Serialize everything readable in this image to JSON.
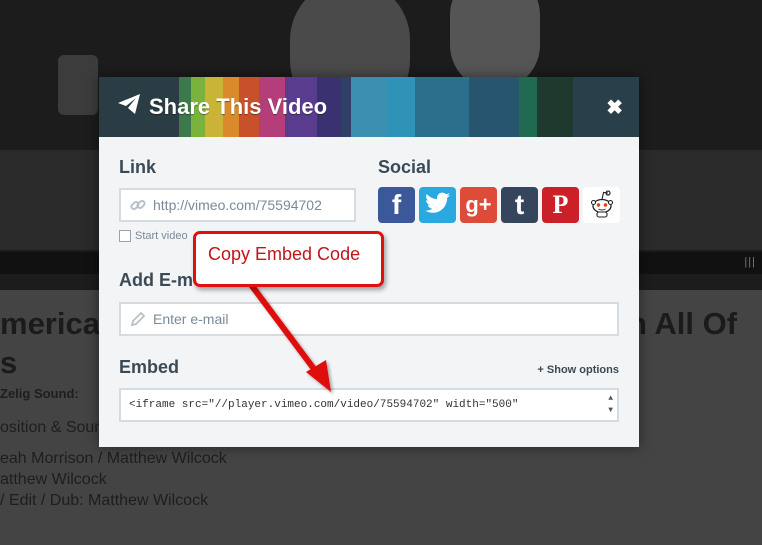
{
  "background": {
    "title_left_line1": "merica",
    "title_left_line2": "s",
    "title_right": "n All Of",
    "credits_line": "Zelig Sound:",
    "line1": "osition & Sound",
    "line2": "eah Morrison / Matthew Wilcock",
    "line3": "atthew Wilcock",
    "line4": "/ Edit / Dub: Matthew Wilcock"
  },
  "modal": {
    "title": "Share This Video",
    "close_glyph": "✖",
    "link": {
      "label": "Link",
      "value": "http://vimeo.com/75594702",
      "checkbox_label": "Start video"
    },
    "social": {
      "label": "Social",
      "buttons": [
        {
          "name": "facebook",
          "glyph": "f",
          "color": "#3b5998"
        },
        {
          "name": "twitter",
          "glyph": "t",
          "color": "#2aa9e0"
        },
        {
          "name": "google-plus",
          "glyph": "g+",
          "color": "#dd4b39"
        },
        {
          "name": "tumblr",
          "glyph": "t",
          "color": "#35465c"
        },
        {
          "name": "pinterest",
          "glyph": "P",
          "color": "#cb2027"
        },
        {
          "name": "reddit",
          "glyph": "",
          "color": "#ffffff"
        }
      ]
    },
    "email": {
      "label": "Add E-m",
      "placeholder": "Enter e-mail"
    },
    "embed": {
      "label": "Embed",
      "show_options": "+ Show options",
      "code": "<iframe src=\"//player.vimeo.com/video/75594702\" width=\"500\""
    }
  },
  "annotation": {
    "text": "Copy Embed Code",
    "color": "#e01010"
  },
  "header_stripe_colors": [
    "#2b3d44",
    "#3c7a4a",
    "#7ab33b",
    "#c9b437",
    "#d98a2a",
    "#c8502a",
    "#b43e7a",
    "#5a3c8e",
    "#3a3270",
    "#2f3f66",
    "#3c8fb1",
    "#2f93b8",
    "#2b6f8c",
    "#27556f",
    "#1f6a50",
    "#1e3a2e",
    "#29404a"
  ]
}
